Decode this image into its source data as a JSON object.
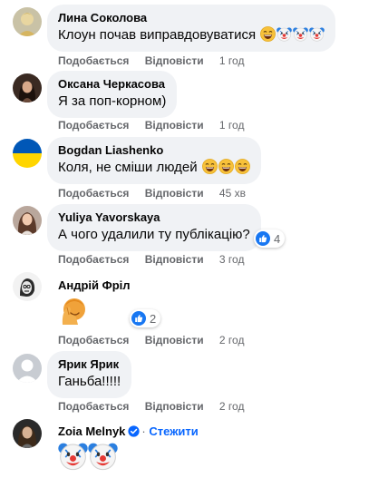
{
  "actions": {
    "like": "Подобається",
    "reply": "Відповісти"
  },
  "comments": [
    {
      "author": "Лина Соколова",
      "text": "Клоун почав виправдовуватися",
      "time": "1 год"
    },
    {
      "author": "Оксана Черкасова",
      "text": "Я за поп-корном)",
      "time": "1 год"
    },
    {
      "author": "Bogdan Liashenko",
      "text": "Коля, не сміши людей",
      "time": "45 хв"
    },
    {
      "author": "Yuliya Yavorskaya",
      "text": "А чого удалили ту публікацію?",
      "time": "3 год",
      "reactions": "4"
    },
    {
      "author": "Андрій Фріл",
      "time": "2 год",
      "reactions": "2"
    },
    {
      "author": "Ярик Ярик",
      "text": "Ганьба!!!!!",
      "time": "2 год"
    },
    {
      "author": "Zoia Melnyk",
      "follow": "Стежити",
      "separator": "·"
    }
  ],
  "icons": {
    "emoji_grin": "grinning-face-emoji",
    "emoji_clown": "clown-face-emoji",
    "sticker_facepalm": "facepalm-emoji-sticker",
    "like_badge": "like-thumb-icon",
    "verified": "verified-badge-icon"
  },
  "colors": {
    "bubble": "#f0f2f5",
    "action_text": "#65676b",
    "link_blue": "#0866ff",
    "ukraine_blue": "#0057b7",
    "ukraine_yellow": "#ffd500"
  }
}
